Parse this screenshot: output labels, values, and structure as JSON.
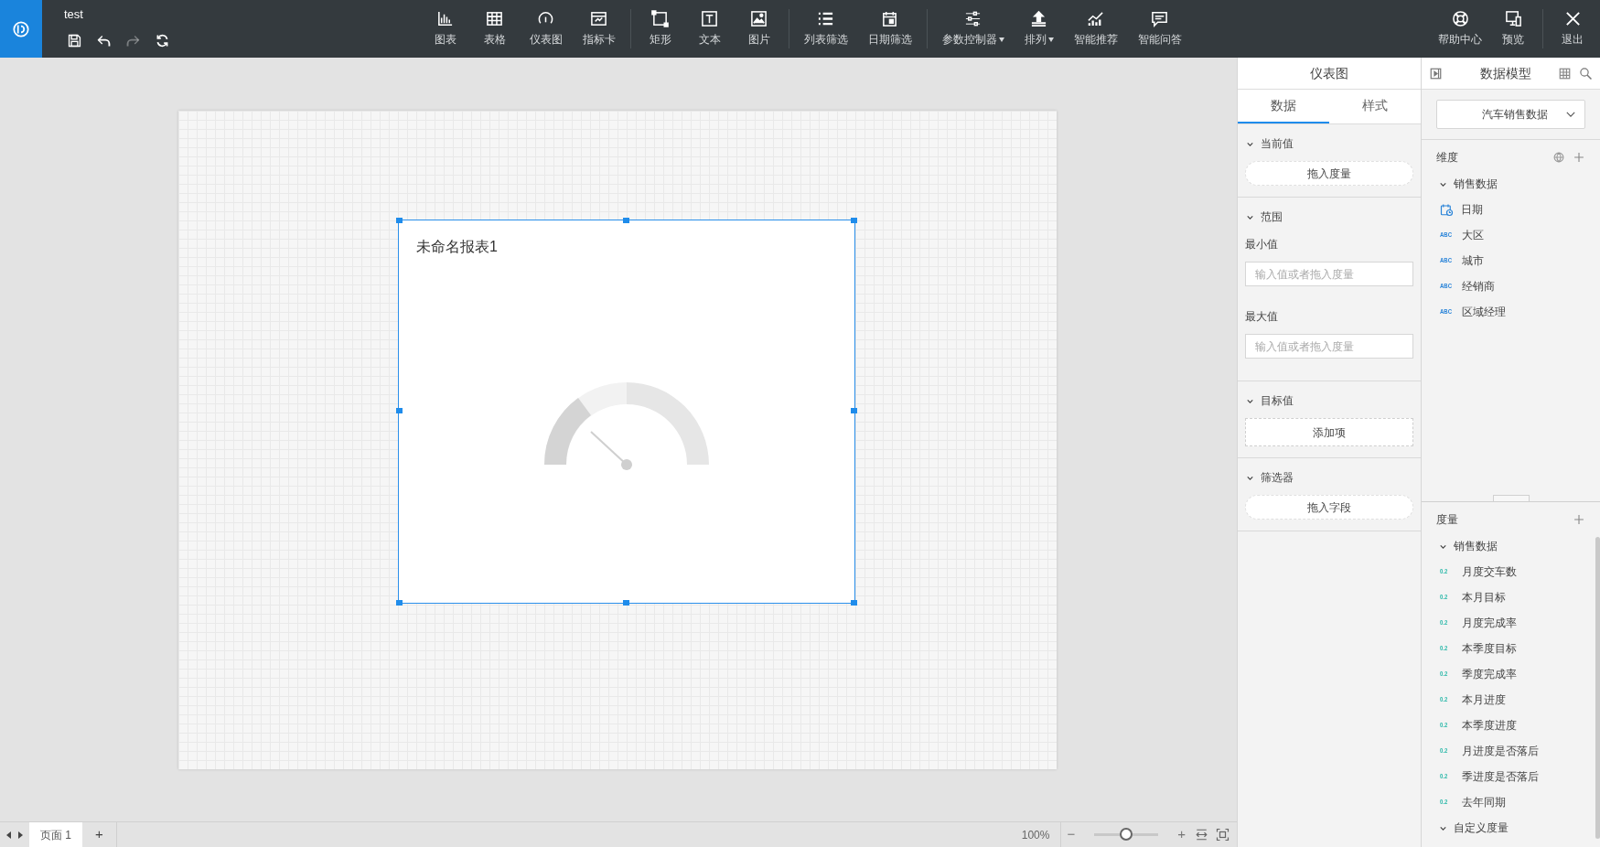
{
  "toolbar": {
    "doc_title": "test",
    "quick_actions": [
      {
        "kind": "save",
        "disabled": false
      },
      {
        "kind": "undo",
        "disabled": false
      },
      {
        "kind": "redo",
        "disabled": true
      },
      {
        "kind": "refresh",
        "disabled": false
      }
    ],
    "tool_groups": [
      [
        {
          "label": "图表",
          "kind": "bar",
          "dropdown": false
        },
        {
          "label": "表格",
          "kind": "table",
          "dropdown": false
        },
        {
          "label": "仪表图",
          "kind": "gauge",
          "dropdown": false
        },
        {
          "label": "指标卡",
          "kind": "card",
          "dropdown": false
        }
      ],
      [
        {
          "label": "矩形",
          "kind": "rect",
          "dropdown": false
        },
        {
          "label": "文本",
          "kind": "text",
          "dropdown": false
        },
        {
          "label": "图片",
          "kind": "image",
          "dropdown": false
        }
      ],
      [
        {
          "label": "列表筛选",
          "kind": "list",
          "dropdown": false
        },
        {
          "label": "日期筛选",
          "kind": "calendar",
          "dropdown": false
        }
      ],
      [
        {
          "label": "参数控制器",
          "kind": "sliders",
          "dropdown": true
        },
        {
          "label": "排列",
          "kind": "arrange",
          "dropdown": true
        },
        {
          "label": "智能推荐",
          "kind": "trend",
          "dropdown": false
        },
        {
          "label": "智能问答",
          "kind": "chat",
          "dropdown": false
        }
      ]
    ],
    "right_tools": [
      [
        {
          "label": "帮助中心",
          "kind": "help"
        },
        {
          "label": "预览",
          "kind": "preview"
        }
      ],
      [
        {
          "label": "退出",
          "kind": "close"
        }
      ]
    ]
  },
  "canvas": {
    "card": {
      "title": "未命名报表1",
      "selected": true
    }
  },
  "property_panel": {
    "title": "仪表图",
    "tabs": [
      {
        "label": "数据",
        "selected": true
      },
      {
        "label": "样式",
        "selected": false
      }
    ],
    "sections": [
      {
        "title": "当前值",
        "expanded": true,
        "fields": [
          {
            "kind": "drop",
            "text": "拖入度量"
          }
        ]
      },
      {
        "title": "范围",
        "expanded": true,
        "fields": [
          {
            "kind": "input",
            "label": "最小值",
            "placeholder": "输入值或者拖入度量"
          },
          {
            "kind": "input",
            "label": "最大值",
            "placeholder": "输入值或者拖入度量"
          }
        ]
      },
      {
        "title": "目标值",
        "expanded": true,
        "fields": [
          {
            "kind": "add",
            "text": "添加项"
          }
        ]
      },
      {
        "title": "筛选器",
        "expanded": true,
        "fields": [
          {
            "kind": "drop",
            "text": "拖入字段"
          }
        ]
      }
    ]
  },
  "data_model": {
    "title": "数据模型",
    "dataset": "汽车销售数据",
    "dimensions": {
      "label": "维度",
      "groups": [
        {
          "label": "销售数据",
          "expanded": true,
          "children": [
            {
              "label": "日期",
              "kind": "date"
            },
            {
              "label": "大区",
              "kind": "text",
              "badge": "ABC"
            },
            {
              "label": "城市",
              "kind": "text",
              "badge": "ABC"
            },
            {
              "label": "经销商",
              "kind": "text",
              "badge": "ABC"
            },
            {
              "label": "区域经理",
              "kind": "text",
              "badge": "ABC"
            }
          ]
        }
      ]
    },
    "measures": {
      "label": "度量",
      "groups": [
        {
          "label": "销售数据",
          "expanded": true,
          "children": [
            {
              "label": "月度交车数",
              "badge": "0.2"
            },
            {
              "label": "本月目标",
              "badge": "0.2"
            },
            {
              "label": "月度完成率",
              "badge": "0.2"
            },
            {
              "label": "本季度目标",
              "badge": "0.2"
            },
            {
              "label": "季度完成率",
              "badge": "0.2"
            },
            {
              "label": "本月进度",
              "badge": "0.2"
            },
            {
              "label": "本季度进度",
              "badge": "0.2"
            },
            {
              "label": "月进度是否落后",
              "badge": "0.2"
            },
            {
              "label": "季进度是否落后",
              "badge": "0.2"
            },
            {
              "label": "去年同期",
              "badge": "0.2"
            }
          ]
        },
        {
          "label": "自定义度量",
          "expanded": true
        }
      ]
    }
  },
  "bottom_bar": {
    "pages": [
      {
        "label": "页面 1",
        "selected": true
      }
    ],
    "add": "+",
    "zoom": "100%",
    "zoom_out": "−",
    "zoom_in": "+",
    "zoom_slider": {
      "level": 0.5
    }
  }
}
